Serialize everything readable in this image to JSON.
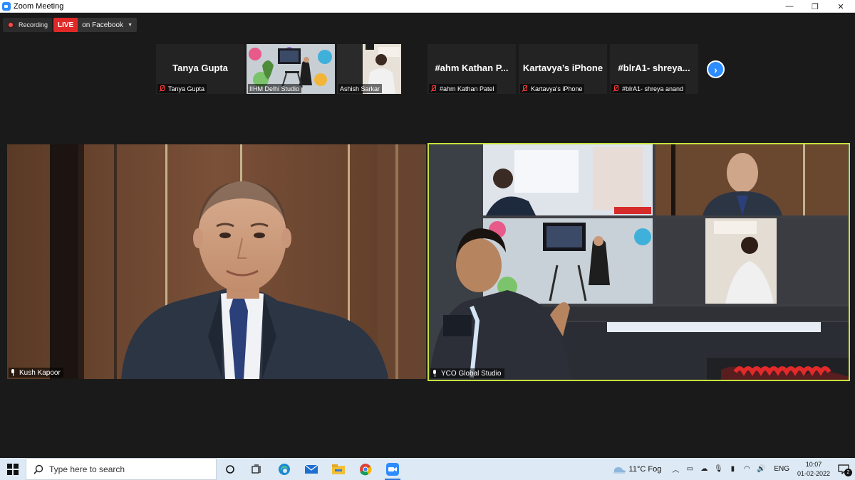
{
  "window": {
    "title": "Zoom Meeting",
    "controls": {
      "minimize": "—",
      "restore": "❐",
      "close": "✕"
    }
  },
  "recording": {
    "label": "Recording"
  },
  "live_stream": {
    "badge": "LIVE",
    "destination": "on Facebook"
  },
  "gallery": {
    "thumbnails": [
      {
        "name": "Tanya Gupta",
        "label": "Tanya Gupta",
        "muted": true,
        "has_video": false
      },
      {
        "name": "",
        "label": "IIHM Delhi Studio",
        "muted": false,
        "has_video": true
      },
      {
        "name": "",
        "label": "Ashish Sarkar",
        "muted": false,
        "has_video": true
      },
      {
        "name": "#ahm  Kathan  P...",
        "label": "#ahm Kathan Patel",
        "muted": true,
        "has_video": false
      },
      {
        "name": "Kartavya’s iPhone",
        "label": "Kartavya’s iPhone",
        "muted": true,
        "has_video": false
      },
      {
        "name": "#blrA1-  shreya...",
        "label": "#blrA1- shreya anand",
        "muted": true,
        "has_video": false
      }
    ],
    "next_icon": "chevron-right-icon"
  },
  "main_videos": [
    {
      "label": "Kush Kapoor"
    },
    {
      "label": "YCO Global Studio",
      "active_speaker": true
    }
  ],
  "taskbar": {
    "search_placeholder": "Type here to search",
    "apps": [
      "task-view-icon",
      "widgets-icon",
      "edge-icon",
      "mail-icon",
      "file-explorer-icon",
      "chrome-icon",
      "zoom-icon"
    ],
    "weather": "11°C  Fog",
    "language": "ENG",
    "time": "10:07",
    "date": "01-02-2022",
    "notification_count": "2"
  },
  "colors": {
    "speaker_border": "#c8e03c",
    "live_red": "#e02828",
    "zoom_blue": "#2d8cff",
    "stage_bg": "#1a1a1a"
  }
}
